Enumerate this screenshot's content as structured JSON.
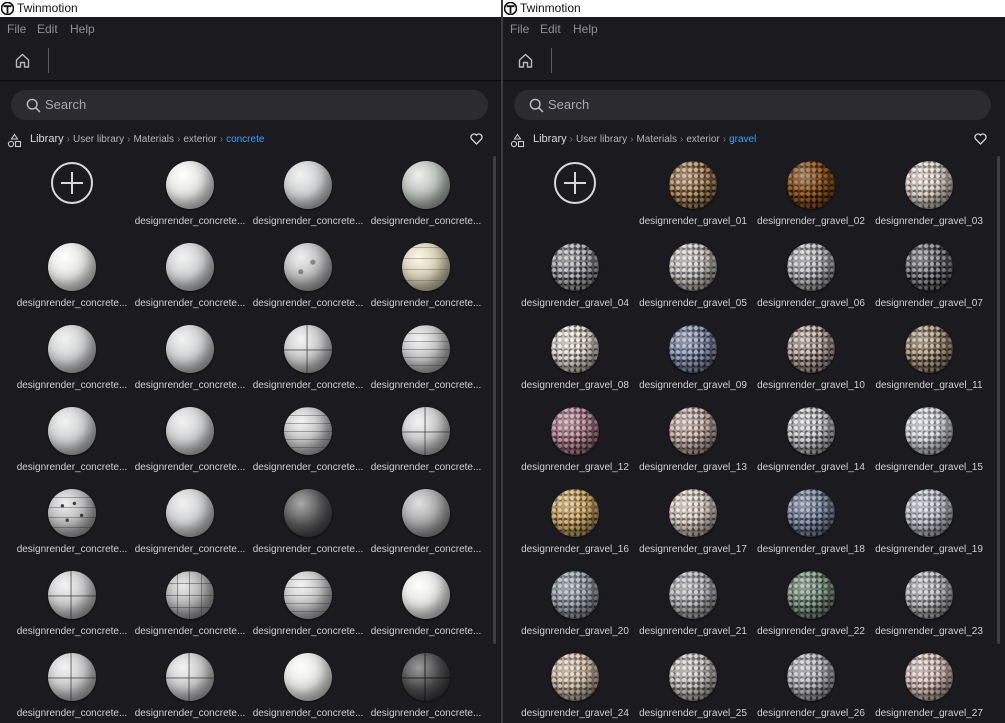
{
  "windows": [
    {
      "title": "Twinmotion",
      "menu": [
        "File",
        "Edit",
        "Help"
      ],
      "search_placeholder": "Search",
      "breadcrumb": [
        "Library",
        "User library",
        "Materials",
        "exterior",
        "concrete"
      ],
      "add_item": true,
      "items": [
        {
          "label": "designrender_concrete...",
          "material": "white"
        },
        {
          "label": "designrender_concrete...",
          "material": "lgrey"
        },
        {
          "label": "designrender_concrete...",
          "material": "green"
        },
        {
          "label": "designrender_concrete...",
          "material": "white"
        },
        {
          "label": "designrender_concrete...",
          "material": "lgrey"
        },
        {
          "label": "designrender_concrete...",
          "material": "spotted"
        },
        {
          "label": "designrender_concrete...",
          "material": "cream-lines"
        },
        {
          "label": "designrender_concrete...",
          "material": "lgrey"
        },
        {
          "label": "designrender_concrete...",
          "material": "lgrey"
        },
        {
          "label": "designrender_concrete...",
          "material": "cross"
        },
        {
          "label": "designrender_concrete...",
          "material": "planks"
        },
        {
          "label": "designrender_concrete...",
          "material": "lgrey"
        },
        {
          "label": "designrender_concrete...",
          "material": "lgrey"
        },
        {
          "label": "designrender_concrete...",
          "material": "planks"
        },
        {
          "label": "designrender_concrete...",
          "material": "cross"
        },
        {
          "label": "designrender_concrete...",
          "material": "holes"
        },
        {
          "label": "designrender_concrete...",
          "material": "lgrey"
        },
        {
          "label": "designrender_concrete...",
          "material": "dark"
        },
        {
          "label": "designrender_concrete...",
          "material": "mid"
        },
        {
          "label": "designrender_concrete...",
          "material": "cross"
        },
        {
          "label": "designrender_concrete...",
          "material": "tiles"
        },
        {
          "label": "designrender_concrete...",
          "material": "planks"
        },
        {
          "label": "designrender_concrete...",
          "material": "white"
        },
        {
          "label": "designrender_concrete...",
          "material": "cross"
        },
        {
          "label": "designrender_concrete...",
          "material": "cross"
        },
        {
          "label": "designrender_concrete...",
          "material": "white"
        },
        {
          "label": "designrender_concrete...",
          "material": "cross-dark"
        }
      ]
    },
    {
      "title": "Twinmotion",
      "menu": [
        "File",
        "Edit",
        "Help"
      ],
      "search_placeholder": "Search",
      "breadcrumb": [
        "Library",
        "User library",
        "Materials",
        "exterior",
        "gravel"
      ],
      "add_item": true,
      "items": [
        {
          "label": "designrender_gravel_01",
          "colors": [
            "#3b2a1c",
            "#c7ab80",
            "#7a5a3a"
          ]
        },
        {
          "label": "designrender_gravel_02",
          "colors": [
            "#2a1608",
            "#a86a2c",
            "#6b3e16"
          ]
        },
        {
          "label": "designrender_gravel_03",
          "colors": [
            "#6e645c",
            "#ede6dc",
            "#b4aca2"
          ]
        },
        {
          "label": "designrender_gravel_04",
          "colors": [
            "#2c2c30",
            "#c3c3c7",
            "#75757a"
          ]
        },
        {
          "label": "designrender_gravel_05",
          "colors": [
            "#57575b",
            "#e1dcd6",
            "#a29e98"
          ]
        },
        {
          "label": "designrender_gravel_06",
          "colors": [
            "#4b4b4f",
            "#d4d4d6",
            "#8d8d91"
          ]
        },
        {
          "label": "designrender_gravel_07",
          "colors": [
            "#18181a",
            "#a0a0a6",
            "#4d4d52"
          ]
        },
        {
          "label": "designrender_gravel_08",
          "colors": [
            "#5e574f",
            "#f1eee8",
            "#b8b1a8"
          ]
        },
        {
          "label": "designrender_gravel_09",
          "colors": [
            "#2c3346",
            "#a9b2c9",
            "#667089"
          ]
        },
        {
          "label": "designrender_gravel_10",
          "colors": [
            "#3a2f2c",
            "#d2c4be",
            "#8a7a74"
          ]
        },
        {
          "label": "designrender_gravel_11",
          "colors": [
            "#3a2e22",
            "#c7b7a2",
            "#7a6a58"
          ]
        },
        {
          "label": "designrender_gravel_12",
          "colors": [
            "#55303a",
            "#caa8b2",
            "#8a6470"
          ]
        },
        {
          "label": "designrender_gravel_13",
          "colors": [
            "#5a4a46",
            "#dccdc7",
            "#a08c86"
          ]
        },
        {
          "label": "designrender_gravel_14",
          "colors": [
            "#4a4a4e",
            "#e0e0e2",
            "#9a9a9e"
          ]
        },
        {
          "label": "designrender_gravel_15",
          "colors": [
            "#6a6e72",
            "#e6eaee",
            "#aeb2b6"
          ]
        },
        {
          "label": "designrender_gravel_16",
          "colors": [
            "#5b4320",
            "#e0c488",
            "#a88a52"
          ]
        },
        {
          "label": "designrender_gravel_17",
          "colors": [
            "#6d625a",
            "#ede4dc",
            "#b8ada4"
          ]
        },
        {
          "label": "designrender_gravel_18",
          "colors": [
            "#2e3444",
            "#9ea8bd",
            "#5f687c"
          ]
        },
        {
          "label": "designrender_gravel_19",
          "colors": [
            "#5a5e66",
            "#d8dce2",
            "#9ca0a8"
          ]
        },
        {
          "label": "designrender_gravel_20",
          "colors": [
            "#454a52",
            "#b8bec6",
            "#7c828a"
          ]
        },
        {
          "label": "designrender_gravel_21",
          "colors": [
            "#58585c",
            "#cfcfd3",
            "#929296"
          ]
        },
        {
          "label": "designrender_gravel_22",
          "colors": [
            "#2c3a30",
            "#9fb2a2",
            "#5e7262"
          ]
        },
        {
          "label": "designrender_gravel_23",
          "colors": [
            "#545458",
            "#d2d2d6",
            "#949498"
          ]
        },
        {
          "label": "designrender_gravel_24",
          "colors": [
            "#6a5a4c",
            "#e4d6c6",
            "#ab9b8a"
          ]
        },
        {
          "label": "designrender_gravel_25",
          "colors": [
            "#585654",
            "#dcdad6",
            "#a09e9a"
          ]
        },
        {
          "label": "designrender_gravel_26",
          "colors": [
            "#4e4e54",
            "#cdcdd3",
            "#8e8e94"
          ]
        },
        {
          "label": "designrender_gravel_27",
          "colors": [
            "#6a5650",
            "#e8d8d2",
            "#ae9a94"
          ]
        }
      ]
    }
  ]
}
